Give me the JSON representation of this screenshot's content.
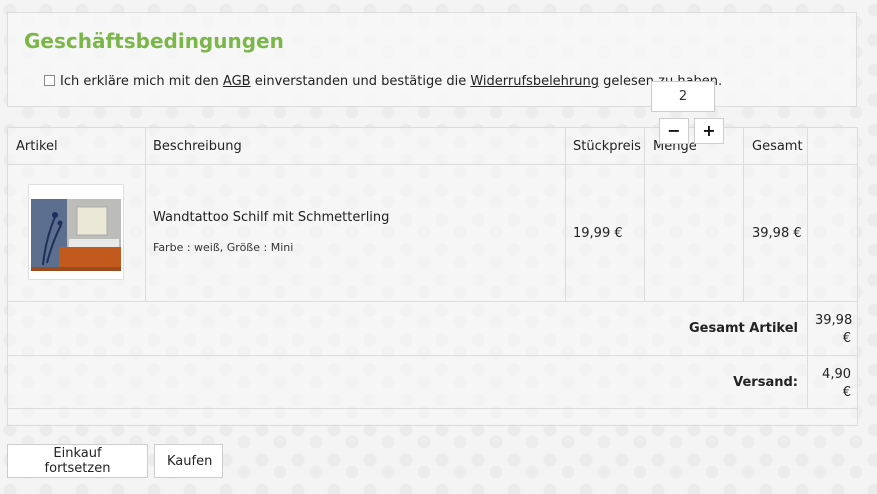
{
  "terms": {
    "title": "Geschäftsbedingungen",
    "text_before": "Ich erkläre mich mit den ",
    "agb_link": "AGB",
    "text_middle": " einverstanden und bestätige die ",
    "withdrawal_link": "Widerrufsbelehrung",
    "text_after": " gelesen zu haben.",
    "checked": false
  },
  "cart": {
    "headers": {
      "article": "Artikel",
      "description": "Beschreibung",
      "unit_price": "Stückpreis",
      "quantity": "Menge",
      "total": "Gesamt"
    },
    "item": {
      "name": "Wandtattoo Schilf mit Schmetterling",
      "options": "Farbe : weiß, Größe : Mini",
      "unit_price": "19,99 €",
      "quantity": "2",
      "total": "39,98 €"
    },
    "summary": {
      "articles_label": "Gesamt Artikel",
      "articles_value_line1": "39,98",
      "articles_value_line2": "€",
      "shipping_label": "Versand:",
      "shipping_value_line1": "4,90",
      "shipping_value_line2": "€"
    }
  },
  "buttons": {
    "continue": "Einkauf fortsetzen",
    "buy": "Kaufen",
    "minus": "−",
    "plus": "+"
  }
}
